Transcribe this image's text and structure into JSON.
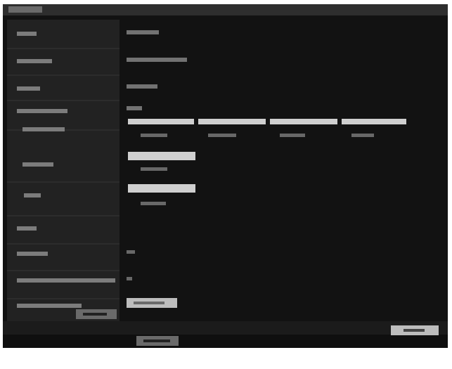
{
  "window": {
    "title": ""
  },
  "form": {
    "rows": [
      {
        "label": "",
        "value": ""
      },
      {
        "label": "",
        "value": ""
      },
      {
        "label": "",
        "value": ""
      },
      {
        "label": "",
        "value": ""
      },
      {
        "label": "",
        "value": ""
      },
      {
        "label": "",
        "value": ""
      },
      {
        "label": "",
        "value": ""
      },
      {
        "label": "",
        "value": ""
      },
      {
        "label": "",
        "value": ""
      },
      {
        "label": "",
        "value": ""
      },
      {
        "label": "",
        "value": ""
      }
    ],
    "table": {
      "columns": [
        "",
        "",
        "",
        ""
      ],
      "cells": [
        "",
        "",
        "",
        ""
      ]
    },
    "buttons": {
      "bottom_left": "",
      "bottom_right": "",
      "bottom_center": "",
      "row_action": ""
    }
  }
}
